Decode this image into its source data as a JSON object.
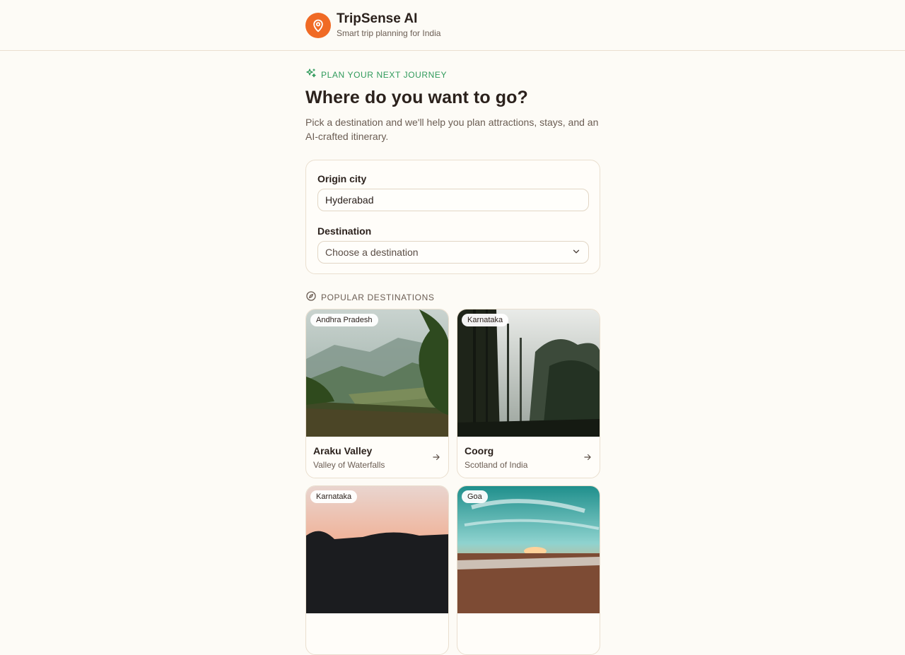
{
  "brand": {
    "name": "TripSense AI",
    "tagline": "Smart trip planning for India",
    "accent": "#f06a25"
  },
  "hero": {
    "eyebrow": "PLAN YOUR NEXT JOURNEY",
    "title": "Where do you want to go?",
    "subtitle": "Pick a destination and we'll help you plan attractions, stays, and an AI-crafted itinerary."
  },
  "form": {
    "origin_label": "Origin city",
    "origin_value": "Hyderabad",
    "destination_label": "Destination",
    "destination_placeholder": "Choose a destination"
  },
  "popular": {
    "title": "POPULAR DESTINATIONS",
    "items": [
      {
        "state": "Andhra Pradesh",
        "name": "Araku Valley",
        "tagline": "Valley of Waterfalls"
      },
      {
        "state": "Karnataka",
        "name": "Coorg",
        "tagline": "Scotland of India"
      },
      {
        "state": "Karnataka",
        "name": "",
        "tagline": ""
      },
      {
        "state": "Goa",
        "name": "",
        "tagline": ""
      }
    ]
  },
  "icons": {
    "logo": "map-pin-icon",
    "eyebrow": "sparkles-icon",
    "section": "compass-icon",
    "select": "chevron-down-icon",
    "card": "arrow-right-icon"
  }
}
